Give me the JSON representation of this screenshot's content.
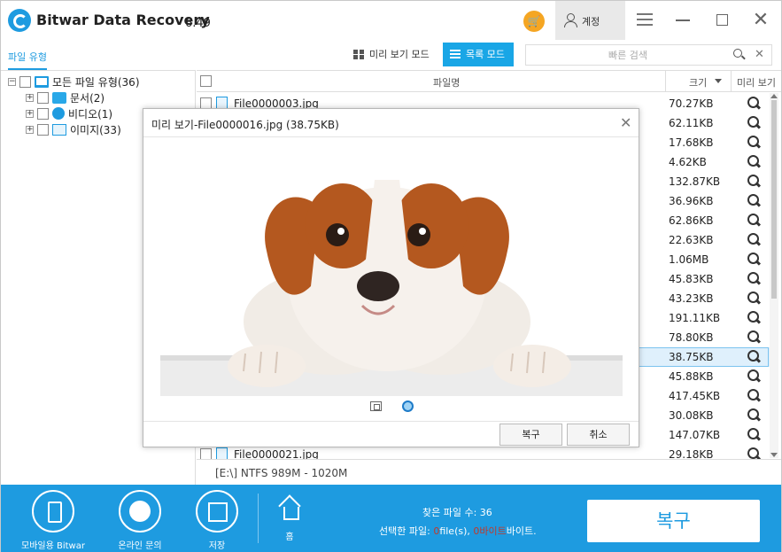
{
  "app": {
    "title": "Bitwar Data Recovery",
    "version": "6.49"
  },
  "account": {
    "label": "계정"
  },
  "toolbar": {
    "tab_file_type": "파일 유형",
    "preview_mode": "미리 보기 모드",
    "list_mode": "목록 모드",
    "search_placeholder": "빠른 검색"
  },
  "tree": {
    "root": "모든 파일 유형(36)",
    "items": [
      {
        "label": "문서(2)",
        "icon": "folder-icon"
      },
      {
        "label": "비디오(1)",
        "icon": "video-icon"
      },
      {
        "label": "이미지(33)",
        "icon": "image-icon"
      }
    ]
  },
  "list": {
    "headers": {
      "name": "파일명",
      "size": "크기",
      "preview": "미리 보기"
    },
    "rows": [
      {
        "name": "File0000003.jpg",
        "size": "70.27KB"
      },
      {
        "name": "",
        "size": "62.11KB"
      },
      {
        "name": "",
        "size": "17.68KB"
      },
      {
        "name": "",
        "size": "4.62KB"
      },
      {
        "name": "",
        "size": "132.87KB"
      },
      {
        "name": "",
        "size": "36.96KB"
      },
      {
        "name": "",
        "size": "62.86KB"
      },
      {
        "name": "",
        "size": "22.63KB"
      },
      {
        "name": "",
        "size": "1.06MB"
      },
      {
        "name": "",
        "size": "45.83KB"
      },
      {
        "name": "",
        "size": "43.23KB"
      },
      {
        "name": "",
        "size": "191.11KB"
      },
      {
        "name": "",
        "size": "78.80KB"
      },
      {
        "name": "",
        "size": "38.75KB",
        "selected": true
      },
      {
        "name": "",
        "size": "45.88KB"
      },
      {
        "name": "",
        "size": "417.45KB"
      },
      {
        "name": "",
        "size": "30.08KB"
      },
      {
        "name": "",
        "size": "147.07KB"
      },
      {
        "name": "File0000021.jpg",
        "size": "29.18KB"
      }
    ],
    "drive_info": "[E:\\] NTFS 989M - 1020M"
  },
  "dialog": {
    "title": "미리 보기-File0000016.jpg (38.75KB)",
    "recover_label": "복구",
    "cancel_label": "취소"
  },
  "bottombar": {
    "mobile_label": "모바일용 Bitwar",
    "support_label": "온라인 문의",
    "save_label": "저장",
    "home_label": "홈",
    "found_text": "찾은 파일 수: 36",
    "selected_prefix": "선택한 파일: ",
    "selected_count": "0",
    "selected_files_unit": "file(s), ",
    "selected_bytes": "0바이트",
    "selected_bytes_unit": "바이트.",
    "recover_label": "복구"
  },
  "colors": {
    "accent": "#1e9be0",
    "cart": "#f5a623",
    "highlight": "#dff0fc"
  }
}
